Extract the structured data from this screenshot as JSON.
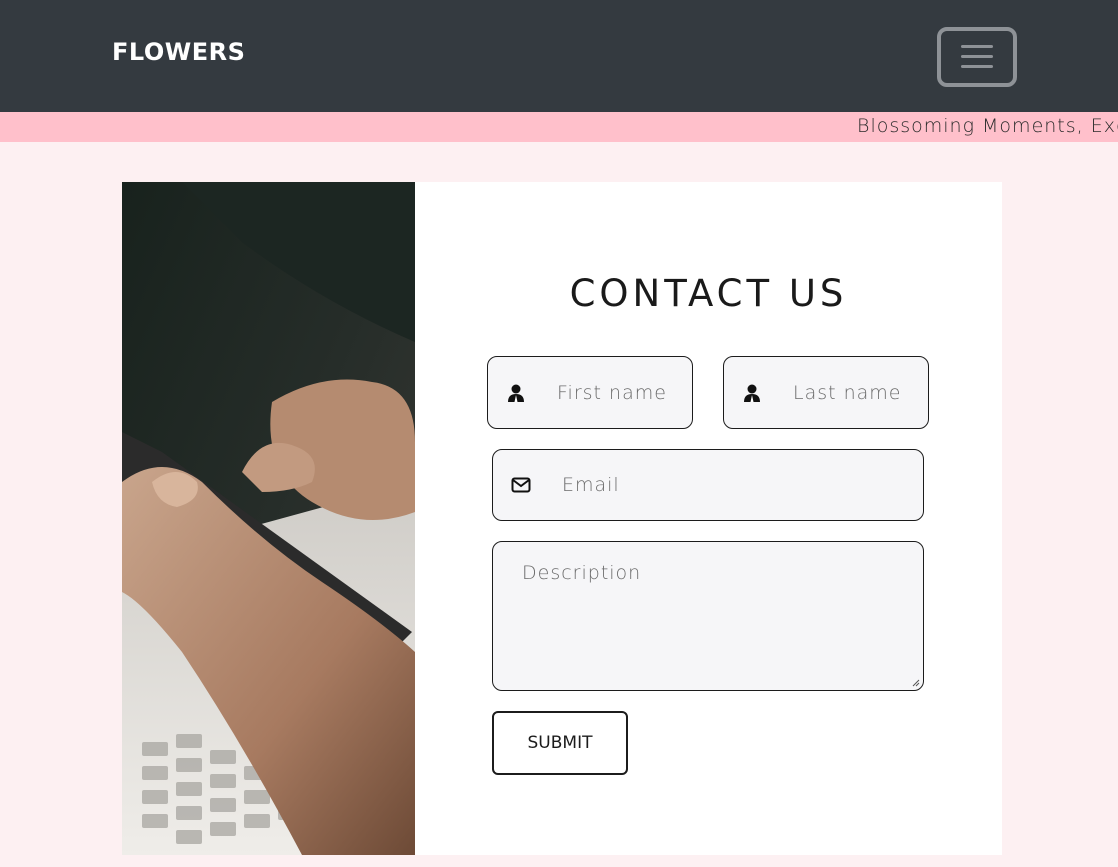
{
  "navbar": {
    "brand": "FLOWERS",
    "menu_icon": "hamburger-menu-icon"
  },
  "ticker": {
    "text": "Blossoming Moments, Exq"
  },
  "photo": {
    "description_icon": "hand-holding-phone-over-laptop-photo"
  },
  "contact": {
    "title": "CONTACT US",
    "first_name_placeholder": "First name",
    "last_name_placeholder": "Last name",
    "email_placeholder": "Email",
    "description_placeholder": "Description",
    "submit_label": "SUBMIT",
    "user_icon": "user-icon",
    "envelope_icon": "envelope-icon"
  },
  "colors": {
    "navbar": "#343a40",
    "ticker": "#ffc0cb",
    "page_background": "#fdf0f2",
    "panel": "#ffffff",
    "field_background": "#f6f6f8"
  }
}
